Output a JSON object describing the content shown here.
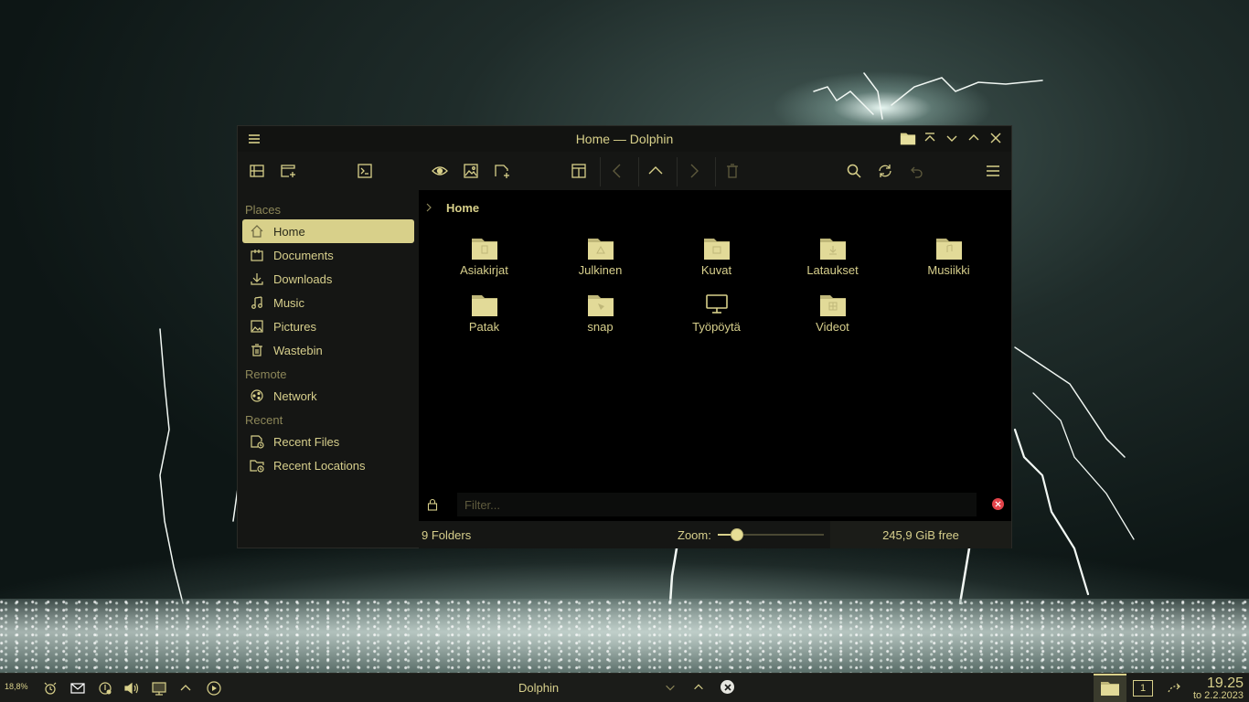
{
  "window": {
    "title": "Home — Dolphin"
  },
  "sidebar": {
    "sections": [
      {
        "title": "Places",
        "items": [
          {
            "label": "Home",
            "icon": "home-icon",
            "active": true
          },
          {
            "label": "Documents",
            "icon": "documents-icon"
          },
          {
            "label": "Downloads",
            "icon": "downloads-icon"
          },
          {
            "label": "Music",
            "icon": "music-icon"
          },
          {
            "label": "Pictures",
            "icon": "pictures-icon"
          },
          {
            "label": "Wastebin",
            "icon": "trash-icon"
          }
        ]
      },
      {
        "title": "Remote",
        "items": [
          {
            "label": "Network",
            "icon": "network-icon"
          }
        ]
      },
      {
        "title": "Recent",
        "items": [
          {
            "label": "Recent Files",
            "icon": "recent-files-icon"
          },
          {
            "label": "Recent Locations",
            "icon": "recent-locations-icon"
          }
        ]
      }
    ]
  },
  "breadcrumb": {
    "current": "Home"
  },
  "files": [
    {
      "name": "Asiakirjat",
      "icon": "folder-documents-icon"
    },
    {
      "name": "Julkinen",
      "icon": "folder-public-icon"
    },
    {
      "name": "Kuvat",
      "icon": "folder-pictures-icon"
    },
    {
      "name": "Lataukset",
      "icon": "folder-downloads-icon"
    },
    {
      "name": "Musiikki",
      "icon": "folder-music-icon"
    },
    {
      "name": "Patak",
      "icon": "folder-icon"
    },
    {
      "name": "snap",
      "icon": "folder-snap-icon"
    },
    {
      "name": "Työpöytä",
      "icon": "desktop-icon"
    },
    {
      "name": "Videot",
      "icon": "folder-videos-icon"
    }
  ],
  "filter": {
    "placeholder": "Filter..."
  },
  "status": {
    "summary": "9 Folders",
    "zoom_label": "Zoom:",
    "zoom_fraction": 0.18,
    "free_space": "245,9 GiB free"
  },
  "taskbar": {
    "cpu": "18,8%",
    "task_title": "Dolphin",
    "pager": "1",
    "time": "19.25",
    "date": "to 2.2.2023"
  },
  "colors": {
    "accent": "#d8d08a",
    "close_red": "#e2434a"
  }
}
